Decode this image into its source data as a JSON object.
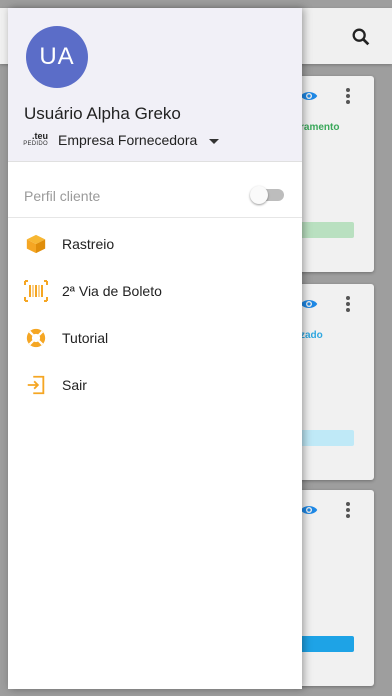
{
  "drawer": {
    "avatar_initials": "UA",
    "user_name": "Usuário Alpha Greko",
    "company": {
      "logo_top": ".teu",
      "logo_bottom": "PEDIDO",
      "name": "Empresa Fornecedora"
    },
    "profile_toggle": {
      "label": "Perfil cliente",
      "on": false
    },
    "menu_items": [
      {
        "label": "Rastreio",
        "icon": "box-icon"
      },
      {
        "label": "2ª Via de Boleto",
        "icon": "barcode-icon"
      },
      {
        "label": "Tutorial",
        "icon": "lifebuoy-icon"
      },
      {
        "label": "Sair",
        "icon": "logout-icon"
      }
    ]
  },
  "background": {
    "cards": [
      {
        "status": "ramento",
        "status_color": "#3aa85a",
        "bar_color": "#b9e0c0"
      },
      {
        "status": "zado",
        "status_color": "#2fa7e0",
        "bar_color": "#bfe9f7"
      },
      {
        "status": "",
        "status_color": "#2fa7e0",
        "bar_color": "#1ea3e6"
      }
    ]
  },
  "colors": {
    "accent_orange": "#f5a623",
    "avatar": "#5b6dc8",
    "eye_blue": "#1e88e5"
  }
}
